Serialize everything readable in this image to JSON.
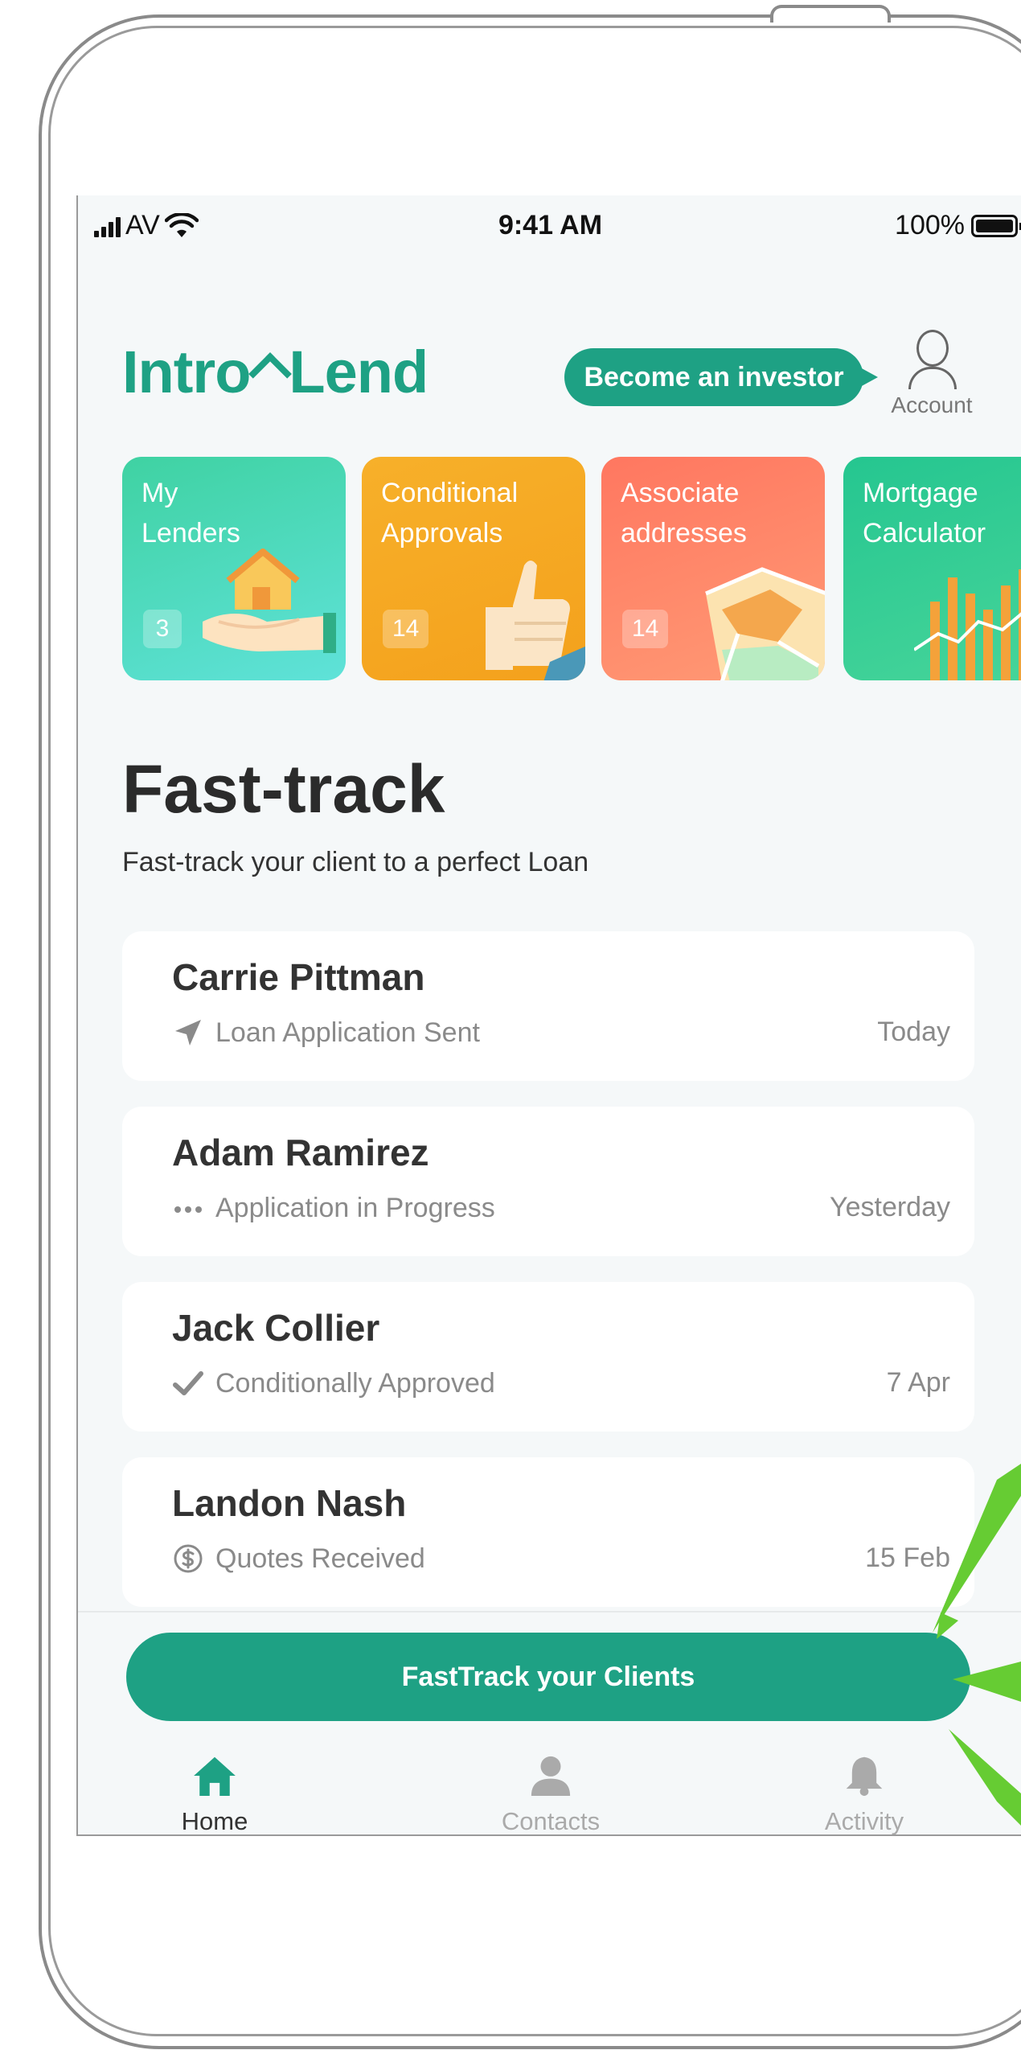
{
  "status_bar": {
    "carrier": "AV",
    "time": "9:41 AM",
    "battery": "100%"
  },
  "header": {
    "logo_left": "Intro",
    "logo_right": "Lend",
    "investor_button": "Become an investor",
    "account_label": "Account"
  },
  "cards": [
    {
      "title_line1": "My",
      "title_line2": "Lenders",
      "count": "3",
      "color": "#3fd2a2"
    },
    {
      "title_line1": "Conditional",
      "title_line2": "Approvals",
      "count": "14",
      "color": "#f7b02a"
    },
    {
      "title_line1": "Associate",
      "title_line2": "addresses",
      "count": "14",
      "color": "#ff7760"
    },
    {
      "title_line1": "Mortgage",
      "title_line2": "Calculator",
      "color": "#25c690"
    }
  ],
  "fast_track": {
    "title": "Fast-track",
    "subtitle": "Fast-track your client to a perfect Loan"
  },
  "clients": [
    {
      "name": "Carrie Pittman",
      "status": "Loan Application Sent",
      "icon": "paper-plane-icon",
      "date": "Today"
    },
    {
      "name": "Adam Ramirez",
      "status": "Application in Progress",
      "icon": "dots-icon",
      "date": "Yesterday"
    },
    {
      "name": "Jack Collier",
      "status": "Conditionally Approved",
      "icon": "check-icon",
      "date": "7 Apr"
    },
    {
      "name": "Landon Nash",
      "status": "Quotes Received",
      "icon": "dollar-icon",
      "date": "15 Feb"
    }
  ],
  "cta": "FastTrack your Clients",
  "tabs": [
    {
      "label": "Home",
      "icon": "home-icon",
      "active": true,
      "color": "#1ea184"
    },
    {
      "label": "Contacts",
      "icon": "person-icon",
      "active": false,
      "color": "#aaaaaa"
    },
    {
      "label": "Activity",
      "icon": "bell-icon",
      "active": false,
      "color": "#aaaaaa"
    }
  ],
  "accent_color": "#1ea184"
}
